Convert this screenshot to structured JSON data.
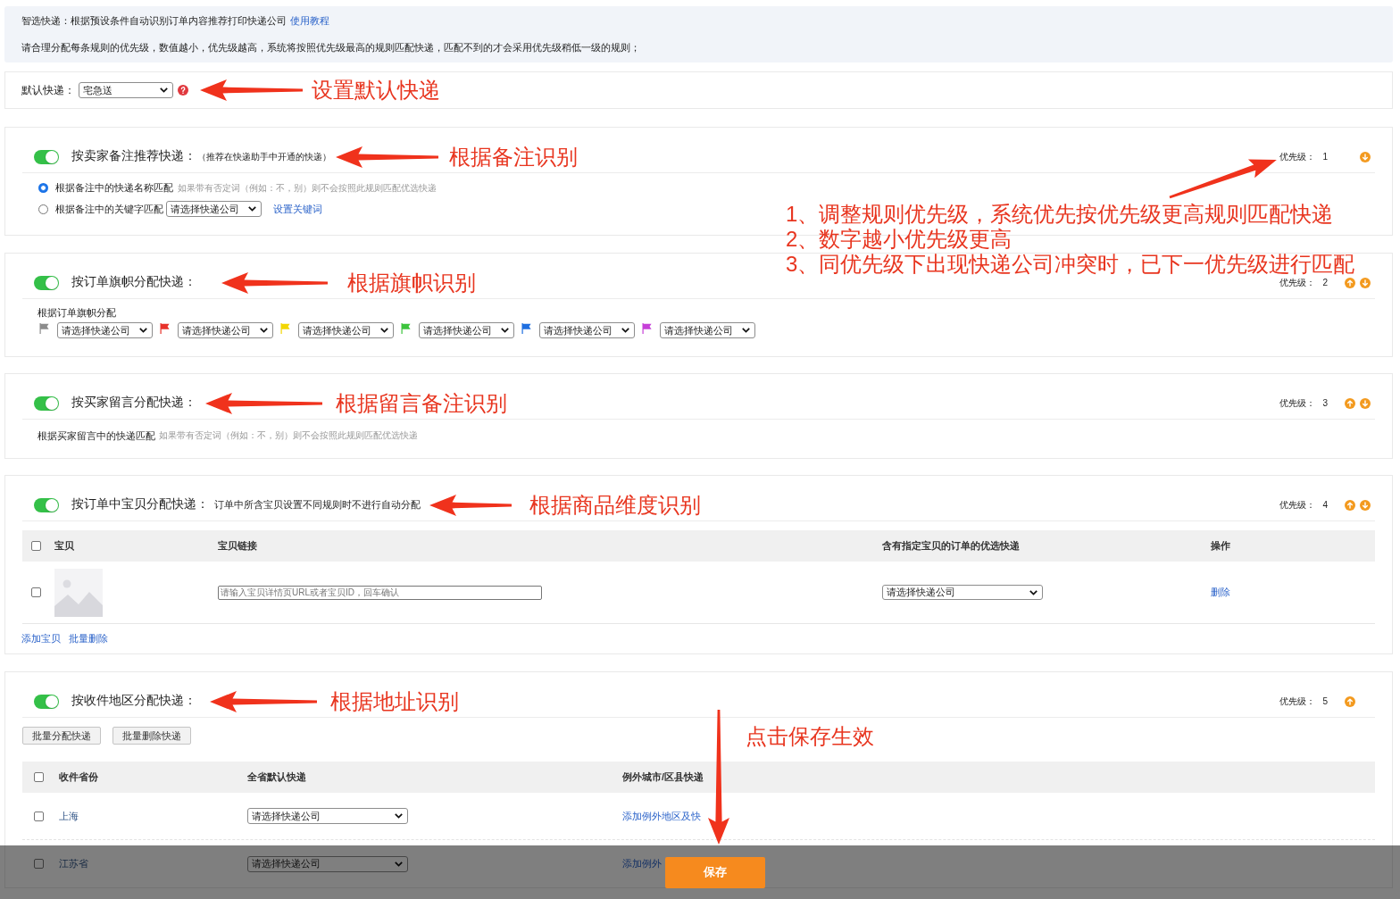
{
  "notice": {
    "intro": "智选快递：根据预设条件自动识别订单内容推荐打印快递公司",
    "link": "使用教程",
    "rule": "请合理分配每条规则的优先级，数值越小，优先级越高，系统将按照优先级最高的规则匹配快递，匹配不到的才会采用优先级稍低一级的规则；"
  },
  "default_express": {
    "label": "默认快递：",
    "value": "宅急送",
    "annotation": "设置默认快递"
  },
  "rules": [
    {
      "kind": "remark",
      "enabled": true,
      "title": "按卖家备注推荐快递：",
      "note": "（推荐在快递助手中开通的快递）",
      "annotation": "根据备注识别",
      "priority_label": "优先级：",
      "priority": "1",
      "can_move_up": false,
      "can_move_down": true,
      "options": [
        {
          "label": "根据备注中的快递名称匹配",
          "hint": "如果带有否定词（例如：不，别）则不会按照此规则匹配优选快递",
          "selected": true
        },
        {
          "label": "根据备注中的关键字匹配",
          "express": "请选择快递公司",
          "link": "设置关键词",
          "selected": false
        }
      ]
    },
    {
      "kind": "flag",
      "enabled": true,
      "title": "按订单旗帜分配快递：",
      "annotation": "根据旗帜识别",
      "priority_label": "优先级：",
      "priority": "2",
      "can_move_up": true,
      "can_move_down": true,
      "caption": "根据订单旗帜分配",
      "flags": [
        {
          "color": "#8c8c8c",
          "express": "请选择快递公司"
        },
        {
          "color": "#e8322a",
          "express": "请选择快递公司"
        },
        {
          "color": "#f2d600",
          "express": "请选择快递公司"
        },
        {
          "color": "#3cc43c",
          "express": "请选择快递公司"
        },
        {
          "color": "#1f6fe0",
          "express": "请选择快递公司"
        },
        {
          "color": "#c640d8",
          "express": "请选择快递公司"
        }
      ]
    },
    {
      "kind": "message",
      "enabled": true,
      "title": "按买家留言分配快递：",
      "annotation": "根据留言备注识别",
      "priority_label": "优先级：",
      "priority": "3",
      "can_move_up": true,
      "can_move_down": true,
      "label": "根据买家留言中的快递匹配",
      "hint": "如果带有否定词（例如：不，别）则不会按照此规则匹配优选快递"
    },
    {
      "kind": "product",
      "enabled": true,
      "title": "按订单中宝贝分配快递：",
      "note": "订单中所含宝贝设置不同规则时不进行自动分配",
      "annotation": "根据商品维度识别",
      "priority_label": "优先级：",
      "priority": "4",
      "can_move_up": true,
      "can_move_down": true,
      "table": {
        "select_all_checked": false,
        "columns": [
          "宝贝",
          "宝贝链接",
          "含有指定宝贝的订单的优选快递",
          "操作"
        ],
        "rows": [
          {
            "checked": false,
            "link_placeholder": "请输入宝贝详情页URL或者宝贝ID，回车确认",
            "express": "请选择快递公司",
            "action": "删除"
          }
        ]
      },
      "links": [
        "添加宝贝",
        "批量删除"
      ]
    },
    {
      "kind": "region",
      "enabled": true,
      "title": "按收件地区分配快递：",
      "annotation": "根据地址识别",
      "priority_label": "优先级：",
      "priority": "5",
      "can_move_up": true,
      "can_move_down": false,
      "buttons": [
        "批量分配快递",
        "批量删除快递"
      ],
      "table": {
        "select_all_checked": false,
        "columns": [
          "收件省份",
          "全省默认快递",
          "例外城市/区县快递"
        ],
        "rows": [
          {
            "checked": false,
            "province": "上海",
            "express": "请选择快递公司",
            "link": "添加例外地区及快"
          },
          {
            "checked": false,
            "province": "江苏省",
            "express": "请选择快递公司",
            "link": "添加例外"
          }
        ]
      }
    }
  ],
  "priority_annotation": [
    "1、调整规则优先级，系统优先按优先级更高规则匹配快递",
    "2、数字越小优先级更高",
    "3、同优先级下出现快递公司冲突时，已下一优先级进行匹配"
  ],
  "save_bar": {
    "button": "保存",
    "annotation": "点击保存生效"
  }
}
